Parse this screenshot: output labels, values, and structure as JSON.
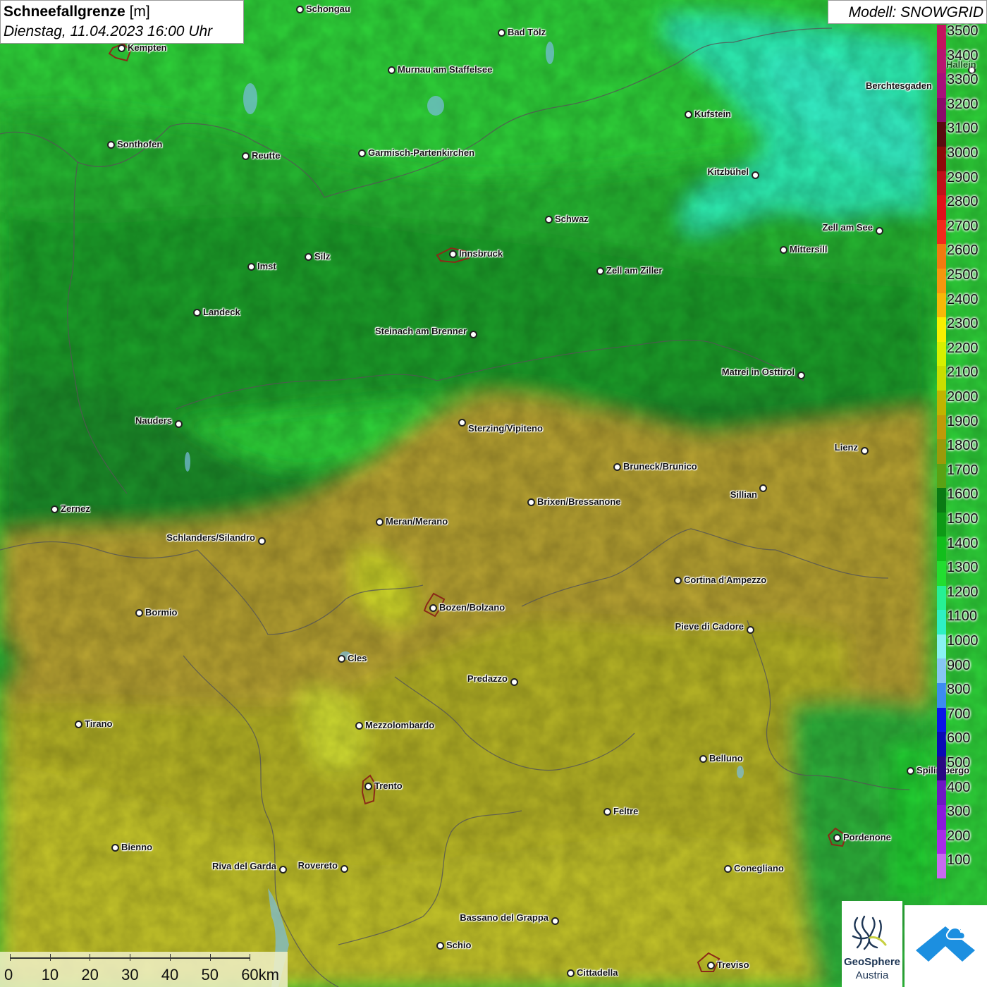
{
  "header": {
    "title_bold": "Schneefallgrenze",
    "title_unit": " [m]",
    "datetime": "Dienstag, 11.04.2023 16:00 Uhr",
    "model": "Modell: SNOWGRID"
  },
  "legend": {
    "labels": [
      "3500",
      "3400",
      "3300",
      "3200",
      "3100",
      "3000",
      "2900",
      "2800",
      "2700",
      "2600",
      "2500",
      "2400",
      "2300",
      "2200",
      "2100",
      "2000",
      "1900",
      "1800",
      "1700",
      "1600",
      "1500",
      "1400",
      "1300",
      "1200",
      "1100",
      "1000",
      "900",
      "800",
      "700",
      "600",
      "500",
      "400",
      "300",
      "200",
      "100"
    ],
    "colors": [
      "#c4145e",
      "#b81570",
      "#a8107a",
      "#8c0a6a",
      "#5a0a10",
      "#8e0a0a",
      "#c0101a",
      "#e0101a",
      "#f22a1c",
      "#f07a10",
      "#f5960e",
      "#f6b808",
      "#f8f000",
      "#d6f000",
      "#c8de00",
      "#c0b400",
      "#bf9a08",
      "#9a9a0a",
      "#5aa214",
      "#0a7a14",
      "#0e9a16",
      "#12be1c",
      "#22de30",
      "#26f094",
      "#2ef0c4",
      "#88f2f2",
      "#86c6f2",
      "#3c8cf0",
      "#0a14e8",
      "#0a0ab4",
      "#2a0a82",
      "#6e18c4",
      "#8a18dc",
      "#a82ae8",
      "#c86af0"
    ]
  },
  "cities": [
    {
      "name": "Schongau"
    },
    {
      "name": "Bad Tölz"
    },
    {
      "name": "Kempten"
    },
    {
      "name": "Murnau am Staffelsee"
    },
    {
      "name": "Berchtesgaden"
    },
    {
      "name": "Hallein"
    },
    {
      "name": "Kufstein"
    },
    {
      "name": "Sonthofen"
    },
    {
      "name": "Reutte"
    },
    {
      "name": "Garmisch-Partenkirchen"
    },
    {
      "name": "Kitzbühel"
    },
    {
      "name": "Schwaz"
    },
    {
      "name": "Zell am See"
    },
    {
      "name": "Innsbruck"
    },
    {
      "name": "Mittersill"
    },
    {
      "name": "Silz"
    },
    {
      "name": "Imst"
    },
    {
      "name": "Zell am Ziller"
    },
    {
      "name": "Landeck"
    },
    {
      "name": "Steinach am Brenner"
    },
    {
      "name": "Matrei in Osttirol"
    },
    {
      "name": "Nauders"
    },
    {
      "name": "Sterzing/Vipiteno"
    },
    {
      "name": "Lienz"
    },
    {
      "name": "Bruneck/Brunico"
    },
    {
      "name": "Sillian"
    },
    {
      "name": "Brixen/Bressanone"
    },
    {
      "name": "Zernez"
    },
    {
      "name": "Meran/Merano"
    },
    {
      "name": "Schlanders/Silandro"
    },
    {
      "name": "Cortina d'Ampezzo"
    },
    {
      "name": "Bozen/Bolzano"
    },
    {
      "name": "Bormio"
    },
    {
      "name": "Pieve di Cadore"
    },
    {
      "name": "Cles"
    },
    {
      "name": "Predazzo"
    },
    {
      "name": "Tirano"
    },
    {
      "name": "Mezzolombardo"
    },
    {
      "name": "Belluno"
    },
    {
      "name": "Spilimbergo"
    },
    {
      "name": "Trento"
    },
    {
      "name": "Feltre"
    },
    {
      "name": "Pordenone"
    },
    {
      "name": "Bienno"
    },
    {
      "name": "Riva del Garda"
    },
    {
      "name": "Rovereto"
    },
    {
      "name": "Conegliano"
    },
    {
      "name": "Bassano del Grappa"
    },
    {
      "name": "Schio"
    },
    {
      "name": "Treviso"
    },
    {
      "name": "Cittadella"
    }
  ],
  "scalebar": {
    "labels": [
      "0",
      "10",
      "20",
      "30",
      "40",
      "50",
      "60km"
    ]
  },
  "logos": {
    "geosphere_line1": "GeoSphere",
    "geosphere_line2": "Austria"
  },
  "colors": {
    "snowline_low_green": "#2fd43a",
    "snowline_dark_green": "#1e8f2a",
    "snowline_olive": "#b9a430",
    "snowline_yellow": "#c8cc2a",
    "snowline_cyan": "#2ff0b4"
  }
}
